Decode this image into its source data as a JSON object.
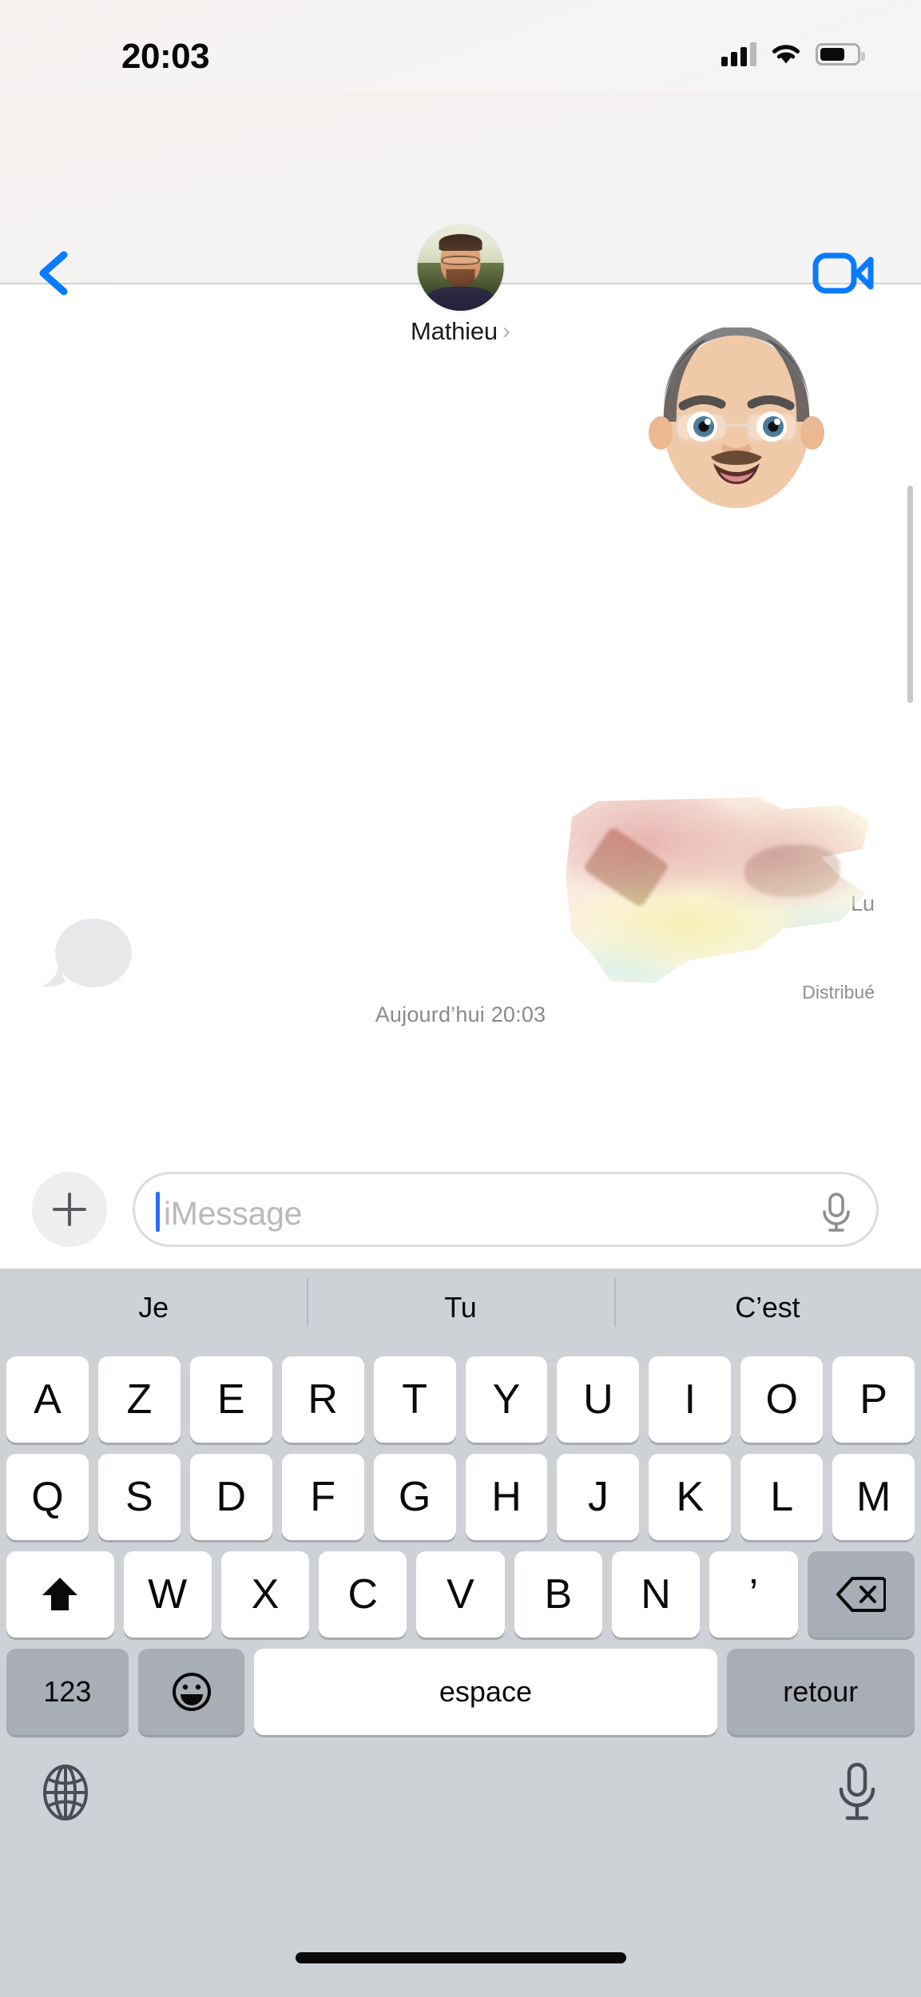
{
  "status_bar": {
    "time": "20:03",
    "cellular_icon": "signal-bars-icon",
    "wifi_icon": "wifi-icon",
    "battery_icon": "battery-icon"
  },
  "nav_bar": {
    "back_icon": "back-chevron-icon",
    "facetime_icon": "video-camera-icon",
    "contact_name": "Mathieu",
    "contact_chevron": "›",
    "avatar_icon": "contact-avatar-photo"
  },
  "conversation": {
    "messages": [
      {
        "type": "sticker",
        "sender": "outgoing",
        "content_icon": "memoji-sticker-bald-man-glasses",
        "status": "Lu"
      },
      {
        "type": "typing-indicator",
        "sender": "incoming",
        "content_icon": "typing-indicator-bubble"
      }
    ],
    "date_divider": "Aujourd’hui 20:03",
    "read_status": "Lu",
    "delivered_status": "Distribué",
    "sticker_icon": "faded-cat-photo-sticker",
    "scrollbar_icon": "vertical-scrollbar"
  },
  "input_bar": {
    "add_button_icon": "plus-icon",
    "placeholder": "iMessage",
    "value": "",
    "mic_icon": "microphone-icon"
  },
  "keyboard": {
    "layout": "AZERTY",
    "predictions": [
      "Je",
      "Tu",
      "C’est"
    ],
    "row1": [
      "A",
      "Z",
      "E",
      "R",
      "T",
      "Y",
      "U",
      "I",
      "O",
      "P"
    ],
    "row2": [
      "Q",
      "S",
      "D",
      "F",
      "G",
      "H",
      "J",
      "K",
      "L",
      "M"
    ],
    "row3_letters": [
      "W",
      "X",
      "C",
      "V",
      "B",
      "N",
      "’"
    ],
    "shift_icon": "shift-arrow-icon",
    "backspace_icon": "backspace-icon",
    "numeric_label": "123",
    "emoji_icon": "emoji-smiley-icon",
    "space_label": "espace",
    "return_label": "retour",
    "globe_icon": "globe-icon",
    "dictation_icon": "dictation-microphone-icon",
    "home_indicator_icon": "home-indicator-bar"
  },
  "colors": {
    "accent_blue": "#0a7bff",
    "caret_blue": "#2d6ef5",
    "keyboard_bg": "#ced1d6",
    "key_white": "#ffffff",
    "key_dark": "#a9adb6",
    "secondary_text": "#8e8e93"
  }
}
